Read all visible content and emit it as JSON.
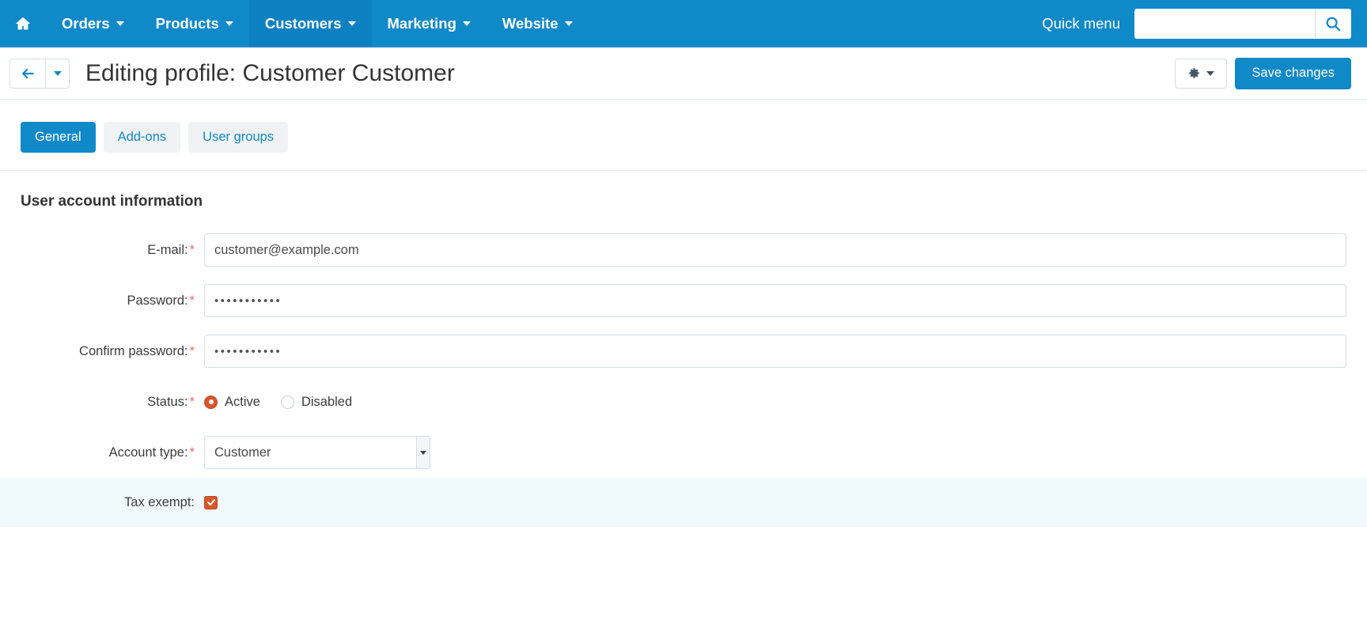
{
  "topnav": {
    "home_icon": "home-icon",
    "items": [
      {
        "label": "Orders",
        "active": false
      },
      {
        "label": "Products",
        "active": false
      },
      {
        "label": "Customers",
        "active": true
      },
      {
        "label": "Marketing",
        "active": false
      },
      {
        "label": "Website",
        "active": false
      }
    ],
    "quick_menu_label": "Quick menu",
    "search_value": "",
    "search_placeholder": "",
    "search_icon": "search-icon",
    "background_color": "#1089c9",
    "active_item_color": "#0b81c1"
  },
  "pageheader": {
    "back_icon": "arrow-left-icon",
    "back_caret_icon": "caret-down-icon",
    "title": "Editing profile: Customer Customer",
    "gear_icon": "gear-icon",
    "gear_caret_icon": "caret-down-icon",
    "save_label": "Save changes",
    "primary_color": "#1089c9"
  },
  "tabs": [
    {
      "label": "General",
      "active": true
    },
    {
      "label": "Add-ons",
      "active": false
    },
    {
      "label": "User groups",
      "active": false
    }
  ],
  "form": {
    "section_title": "User account information",
    "email": {
      "label": "E-mail:",
      "required": "*",
      "value": "customer@example.com",
      "placeholder": ""
    },
    "password": {
      "label": "Password:",
      "required": "*",
      "value": "•••••••••••"
    },
    "confirm_password": {
      "label": "Confirm password:",
      "required": "*",
      "value": "•••••••••••"
    },
    "status": {
      "label": "Status:",
      "required": "*",
      "options": [
        {
          "label": "Active",
          "checked": true
        },
        {
          "label": "Disabled",
          "checked": false
        }
      ],
      "selected_color": "#d9562b"
    },
    "account_type": {
      "label": "Account type:",
      "required": "*",
      "value": "Customer",
      "options": [
        "Customer"
      ]
    },
    "tax_exempt": {
      "label": "Tax exempt:",
      "checked": true,
      "row_background": "#f0f9fd",
      "checkbox_color": "#d9562b"
    }
  }
}
